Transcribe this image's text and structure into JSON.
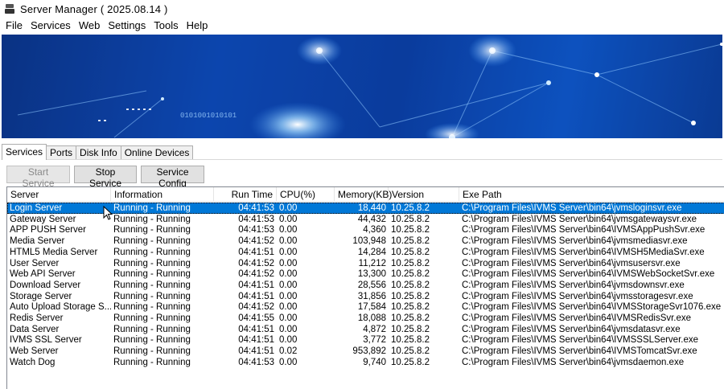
{
  "window": {
    "title": "Server Manager ( 2025.08.14 )"
  },
  "menu": [
    "File",
    "Services",
    "Web",
    "Settings",
    "Tools",
    "Help"
  ],
  "banner": {
    "binary_text": "0101001010101"
  },
  "tabs": [
    {
      "label": "Services",
      "active": true
    },
    {
      "label": "Ports",
      "active": false
    },
    {
      "label": "Disk Info",
      "active": false
    },
    {
      "label": "Online Devices",
      "active": false
    }
  ],
  "toolbar": {
    "start_label": "Start Service",
    "stop_label": "Stop Service",
    "config_label": "Service Config"
  },
  "table": {
    "columns": [
      "Server",
      "Information",
      "Run Time",
      "CPU(%)",
      "Memory(KB)",
      "Version",
      "Exe Path"
    ],
    "rows": [
      [
        "Login Server",
        "Running - Running",
        "04:41:53",
        "0.00",
        "18,440",
        "10.25.8.2",
        "C:\\Program Files\\IVMS Server\\bin64\\jvmsloginsvr.exe"
      ],
      [
        "Gateway Server",
        "Running - Running",
        "04:41:53",
        "0.00",
        "44,432",
        "10.25.8.2",
        "C:\\Program Files\\IVMS Server\\bin64\\jvmsgatewaysvr.exe"
      ],
      [
        "APP PUSH Server",
        "Running - Running",
        "04:41:53",
        "0.00",
        "4,360",
        "10.25.8.2",
        "C:\\Program Files\\IVMS Server\\bin64\\IVMSAppPushSvr.exe"
      ],
      [
        "Media Server",
        "Running - Running",
        "04:41:52",
        "0.00",
        "103,948",
        "10.25.8.2",
        "C:\\Program Files\\IVMS Server\\bin64\\jvmsmediasvr.exe"
      ],
      [
        "HTML5 Media Server",
        "Running - Running",
        "04:41:51",
        "0.00",
        "14,284",
        "10.25.8.2",
        "C:\\Program Files\\IVMS Server\\bin64\\IVMSH5MediaSvr.exe"
      ],
      [
        "User Server",
        "Running - Running",
        "04:41:52",
        "0.00",
        "11,212",
        "10.25.8.2",
        "C:\\Program Files\\IVMS Server\\bin64\\jvmsusersvr.exe"
      ],
      [
        "Web API Server",
        "Running - Running",
        "04:41:52",
        "0.00",
        "13,300",
        "10.25.8.2",
        "C:\\Program Files\\IVMS Server\\bin64\\IVMSWebSocketSvr.exe"
      ],
      [
        "Download Server",
        "Running - Running",
        "04:41:51",
        "0.00",
        "28,556",
        "10.25.8.2",
        "C:\\Program Files\\IVMS Server\\bin64\\jvmsdownsvr.exe"
      ],
      [
        "Storage Server",
        "Running - Running",
        "04:41:51",
        "0.00",
        "31,856",
        "10.25.8.2",
        "C:\\Program Files\\IVMS Server\\bin64\\jvmsstoragesvr.exe"
      ],
      [
        "Auto Upload Storage S...",
        "Running - Running",
        "04:41:52",
        "0.00",
        "17,584",
        "10.25.8.2",
        "C:\\Program Files\\IVMS Server\\bin64\\IVMSStorageSvr1076.exe"
      ],
      [
        "Redis Server",
        "Running - Running",
        "04:41:55",
        "0.00",
        "18,088",
        "10.25.8.2",
        "C:\\Program Files\\IVMS Server\\bin64\\IVMSRedisSvr.exe"
      ],
      [
        "Data Server",
        "Running - Running",
        "04:41:51",
        "0.00",
        "4,872",
        "10.25.8.2",
        "C:\\Program Files\\IVMS Server\\bin64\\jvmsdatasvr.exe"
      ],
      [
        "IVMS SSL Server",
        "Running - Running",
        "04:41:51",
        "0.00",
        "3,772",
        "10.25.8.2",
        "C:\\Program Files\\IVMS Server\\bin64\\IVMSSSLServer.exe"
      ],
      [
        "Web Server",
        "Running - Running",
        "04:41:51",
        "0.02",
        "953,892",
        "10.25.8.2",
        "C:\\Program Files\\IVMS Server\\bin64\\IVMSTomcatSvr.exe"
      ],
      [
        "Watch Dog",
        "Running - Running",
        "04:41:53",
        "0.00",
        "9,740",
        "10.25.8.2",
        "C:\\Program Files\\IVMS Server\\bin64\\jvmsdaemon.exe"
      ]
    ],
    "selected_row": 0
  },
  "colors": {
    "selection": "#0078d7",
    "banner_dark": "#0a2f7a",
    "banner_light": "#0e59c9"
  }
}
